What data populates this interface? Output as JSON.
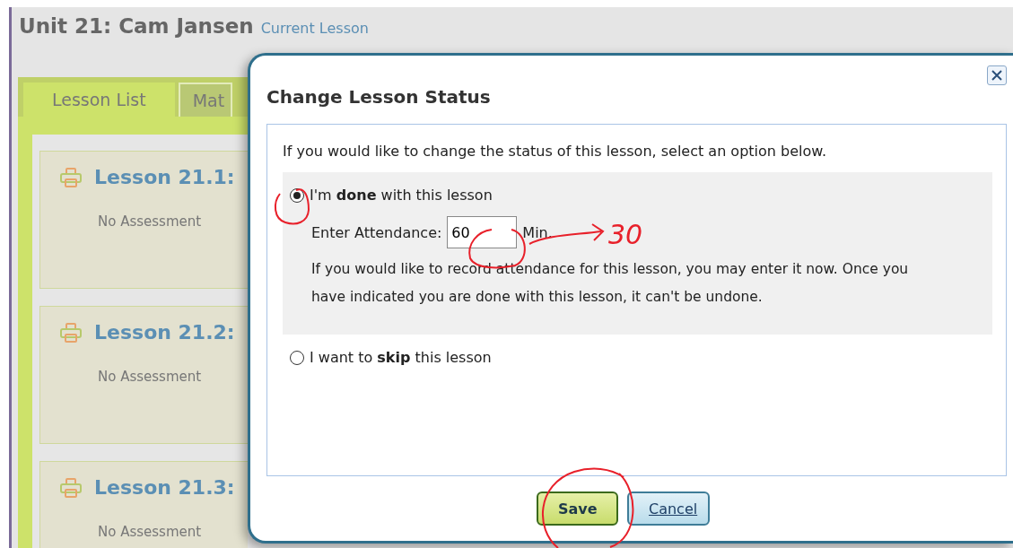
{
  "unit": {
    "title": "Unit 21: Cam Jansen",
    "badge": "Current Lesson"
  },
  "tabs": [
    {
      "label": "Lesson List",
      "selected": true
    },
    {
      "label": "Mat",
      "selected": false
    }
  ],
  "lessons": [
    {
      "title": "Lesson 21.1:",
      "assessment": "No Assessment"
    },
    {
      "title": "Lesson 21.2:",
      "assessment": "No Assessment"
    },
    {
      "title": "Lesson 21.3:",
      "assessment": "No Assessment"
    }
  ],
  "dialog": {
    "title": "Change Lesson Status",
    "intro": "If you would like to change the status of this lesson, select an option below.",
    "options": [
      {
        "kind": "done",
        "label": "I'm **done** with this lesson",
        "selected": true,
        "attendance": {
          "label": "Enter Attendance:",
          "value": "60",
          "unit": "Min."
        },
        "note": "If you would like to record attendance for this lesson, you may enter it now. Once you have indicated you are done with this lesson, it can't be undone."
      },
      {
        "kind": "skip",
        "label": "I want to **skip** this lesson",
        "selected": false
      }
    ],
    "buttons": [
      {
        "kind": "primary",
        "label": "Save"
      },
      {
        "kind": "secondary",
        "label": "Cancel"
      }
    ]
  },
  "annotation": {
    "text": "30"
  }
}
